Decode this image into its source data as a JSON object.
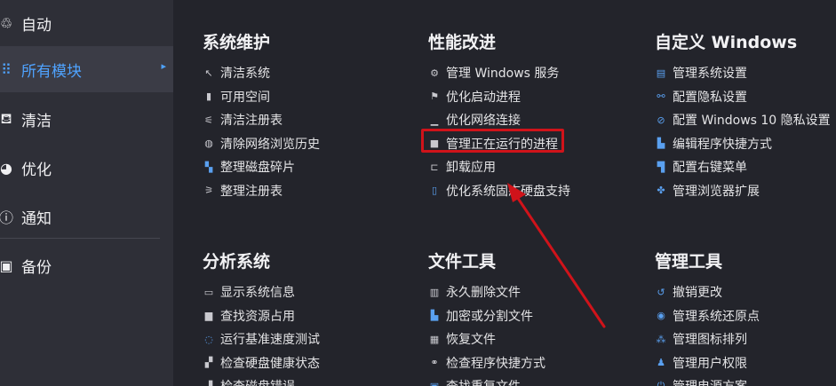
{
  "sidebar": {
    "items": [
      {
        "label": "自动",
        "icon": "robot-icon",
        "glyph": "♲",
        "active": false
      },
      {
        "label": "所有模块",
        "icon": "grid-icon",
        "glyph": "⠿",
        "active": true
      },
      {
        "label": "清洁",
        "icon": "broom-icon",
        "glyph": "⛾",
        "active": false
      },
      {
        "label": "优化",
        "icon": "gauge-icon",
        "glyph": "◕",
        "active": false
      },
      {
        "label": "通知",
        "icon": "info-icon",
        "glyph": "ⓘ",
        "active": false
      },
      {
        "label": "备份",
        "icon": "backup-icon",
        "glyph": "▣",
        "active": false
      }
    ]
  },
  "sections": {
    "maintenance": {
      "title": "系统维护",
      "items": [
        {
          "label": "清洁系统",
          "icon": "cursor-icon",
          "glyph": "↖"
        },
        {
          "label": "可用空间",
          "icon": "file-icon",
          "glyph": "▮"
        },
        {
          "label": "清洁注册表",
          "icon": "registry-icon",
          "glyph": "⚟"
        },
        {
          "label": "清除网络浏览历史",
          "icon": "globe-icon",
          "glyph": "◍"
        },
        {
          "label": "整理磁盘碎片",
          "icon": "defrag-icon",
          "glyph": "▚"
        },
        {
          "label": "整理注册表",
          "icon": "registry-tidy-icon",
          "glyph": "⚞"
        }
      ]
    },
    "performance": {
      "title": "性能改进",
      "items": [
        {
          "label": "管理 Windows 服务",
          "icon": "gears-icon",
          "glyph": "⚙"
        },
        {
          "label": "优化启动进程",
          "icon": "flag-icon",
          "glyph": "⚑"
        },
        {
          "label": "优化网络连接",
          "icon": "network-icon",
          "glyph": "▁"
        },
        {
          "label": "管理正在运行的进程",
          "icon": "process-icon",
          "glyph": "■"
        },
        {
          "label": "卸载应用",
          "icon": "uninstall-icon",
          "glyph": "⊏"
        },
        {
          "label": "优化系统固态硬盘支持",
          "icon": "ssd-icon",
          "glyph": "▯"
        }
      ]
    },
    "customize": {
      "title": "自定义 Windows",
      "items": [
        {
          "label": "管理系统设置",
          "icon": "settings-icon",
          "glyph": "▤"
        },
        {
          "label": "配置隐私设置",
          "icon": "privacy-icon",
          "glyph": "⚯"
        },
        {
          "label": "配置 Windows 10 隐私设置",
          "icon": "no-eye-icon",
          "glyph": "⊘"
        },
        {
          "label": "编辑程序快捷方式",
          "icon": "shortcut-icon",
          "glyph": "▙"
        },
        {
          "label": "配置右键菜单",
          "icon": "context-menu-icon",
          "glyph": "▜"
        },
        {
          "label": "管理浏览器扩展",
          "icon": "puzzle-icon",
          "glyph": "✤"
        }
      ]
    },
    "analysis": {
      "title": "分析系统",
      "items": [
        {
          "label": "显示系统信息",
          "icon": "monitor-icon",
          "glyph": "▭"
        },
        {
          "label": "查找资源占用",
          "icon": "drive-icon",
          "glyph": "▆"
        },
        {
          "label": "运行基准速度测试",
          "icon": "speed-icon",
          "glyph": "◌"
        },
        {
          "label": "检查硬盘健康状态",
          "icon": "disk-health-icon",
          "glyph": "▞"
        },
        {
          "label": "检查磁盘错误",
          "icon": "disk-error-icon",
          "glyph": "▟"
        }
      ]
    },
    "files": {
      "title": "文件工具",
      "items": [
        {
          "label": "永久删除文件",
          "icon": "trash-icon",
          "glyph": "▥"
        },
        {
          "label": "加密或分割文件",
          "icon": "lock-file-icon",
          "glyph": "▙"
        },
        {
          "label": "恢复文件",
          "icon": "restore-file-icon",
          "glyph": "▦"
        },
        {
          "label": "检查程序快捷方式",
          "icon": "broken-link-icon",
          "glyph": "⚭"
        },
        {
          "label": "查找重复文件",
          "icon": "duplicate-icon",
          "glyph": "▣"
        }
      ]
    },
    "admin": {
      "title": "管理工具",
      "items": [
        {
          "label": "撤销更改",
          "icon": "undo-icon",
          "glyph": "↺"
        },
        {
          "label": "管理系统还原点",
          "icon": "restore-point-icon",
          "glyph": "◉"
        },
        {
          "label": "管理图标排列",
          "icon": "icon-layout-icon",
          "glyph": "⁂"
        },
        {
          "label": "管理用户权限",
          "icon": "user-icon",
          "glyph": "♟"
        },
        {
          "label": "管理电源方案",
          "icon": "power-icon",
          "glyph": "⏻"
        }
      ]
    }
  },
  "colors": {
    "background": "#23242b",
    "sidebar": "#2e2f37",
    "accent": "#4fa3ff",
    "highlight": "#d0131a"
  }
}
